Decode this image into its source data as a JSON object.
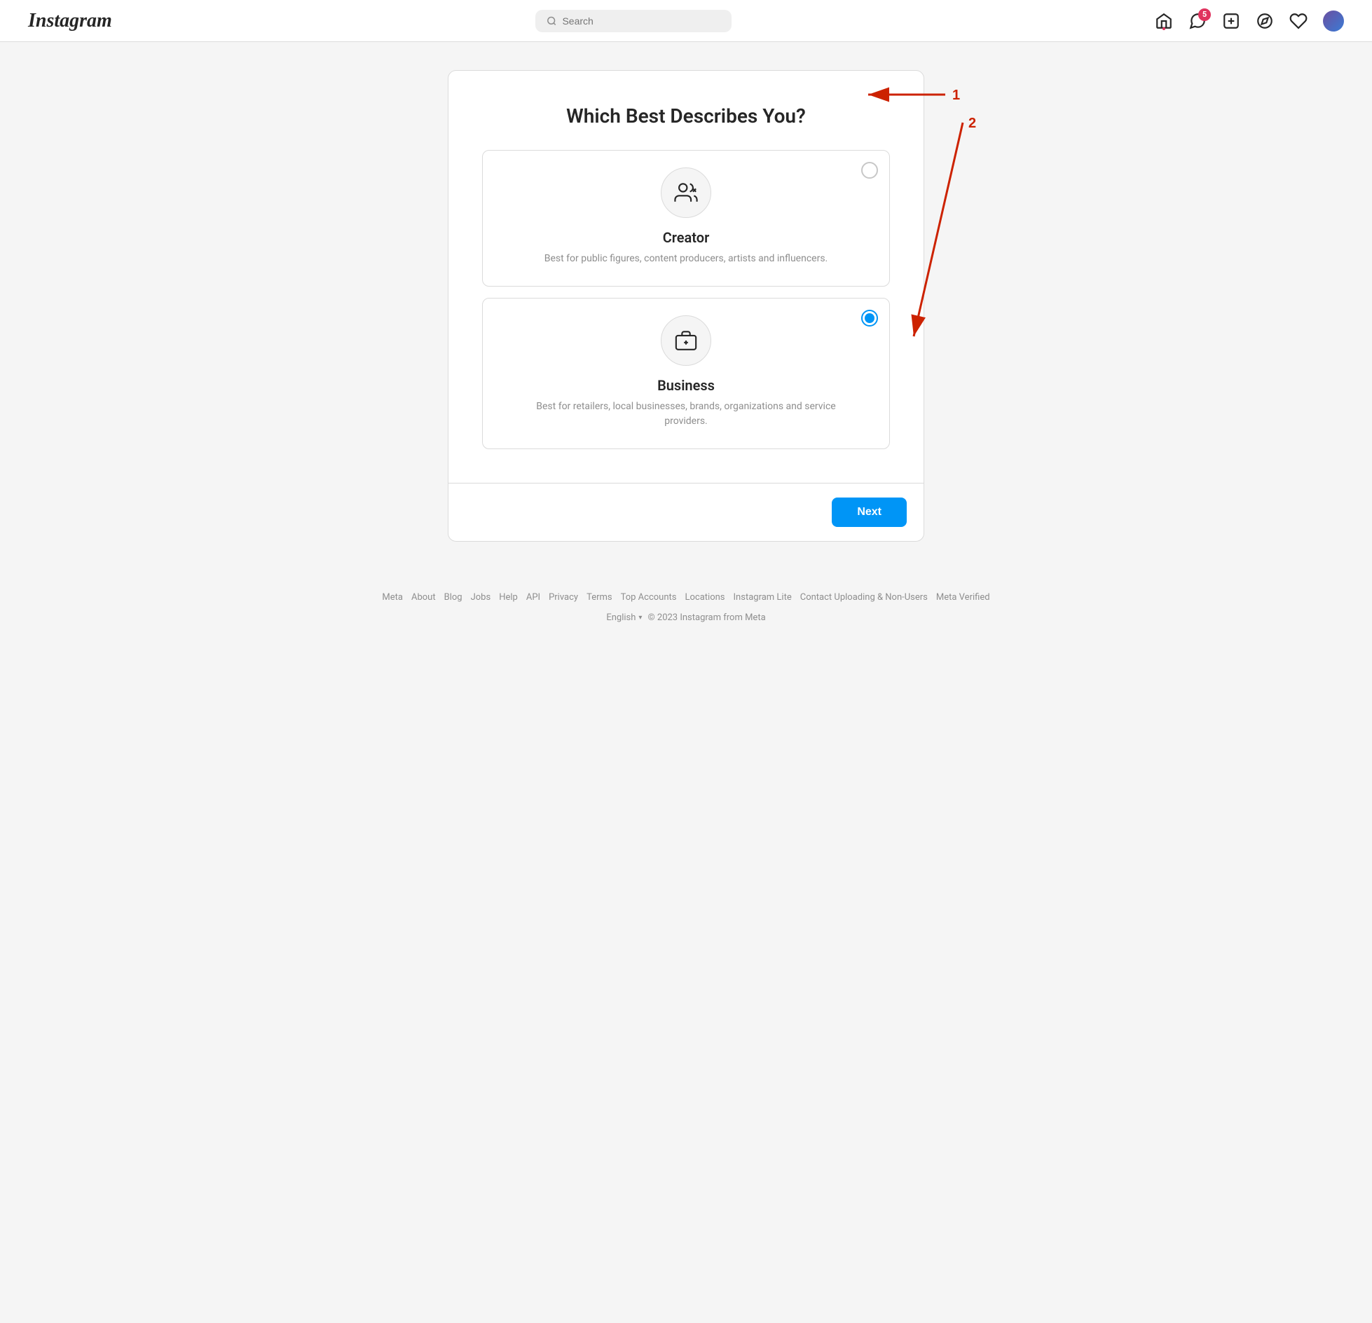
{
  "header": {
    "logo": "Instagram",
    "search_placeholder": "Search",
    "notification_count": "5",
    "nav_icons": [
      "home-icon",
      "messenger-icon",
      "create-icon",
      "explore-icon",
      "heart-icon",
      "avatar"
    ]
  },
  "page": {
    "title": "Which Best Describes You?",
    "options": [
      {
        "id": "creator",
        "label": "Creator",
        "description": "Best for public figures, content producers, artists and influencers.",
        "selected": false
      },
      {
        "id": "business",
        "label": "Business",
        "description": "Best for retailers, local businesses, brands, organizations and service providers.",
        "selected": true
      }
    ],
    "next_button": "Next"
  },
  "annotations": {
    "label1": "1",
    "label2": "2"
  },
  "footer": {
    "links": [
      {
        "label": "Meta"
      },
      {
        "label": "About"
      },
      {
        "label": "Blog"
      },
      {
        "label": "Jobs"
      },
      {
        "label": "Help"
      },
      {
        "label": "API"
      },
      {
        "label": "Privacy"
      },
      {
        "label": "Terms"
      },
      {
        "label": "Top Accounts"
      },
      {
        "label": "Locations"
      },
      {
        "label": "Instagram Lite"
      },
      {
        "label": "Contact Uploading & Non-Users"
      },
      {
        "label": "Meta Verified"
      }
    ],
    "language": "English",
    "copyright": "© 2023 Instagram from Meta"
  }
}
